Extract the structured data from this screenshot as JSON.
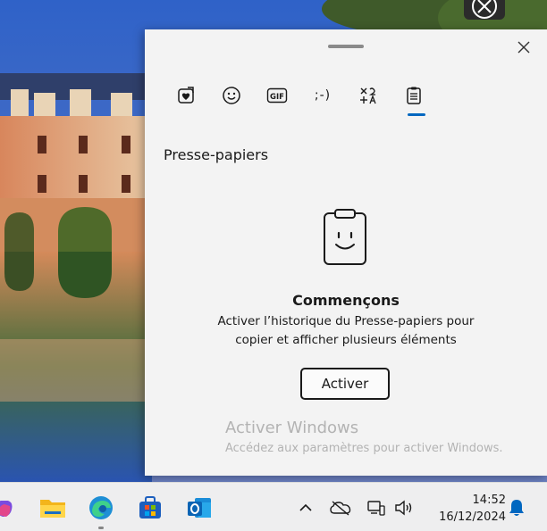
{
  "panel": {
    "tabs": [
      {
        "name": "favorites",
        "icon": "heart-icon"
      },
      {
        "name": "emoji",
        "icon": "smiley-icon"
      },
      {
        "name": "gif",
        "icon": "gif-icon",
        "label": "GIF"
      },
      {
        "name": "kaomoji",
        "icon": "kaomoji-icon",
        "label": ";-)"
      },
      {
        "name": "symbols",
        "icon": "symbols-icon"
      },
      {
        "name": "clipboard",
        "icon": "clipboard-icon",
        "selected": true
      }
    ],
    "section_title": "Presse-papiers",
    "empty_title": "Commençons",
    "empty_desc": "Activer l’historique du Presse-papiers pour copier et afficher plusieurs éléments",
    "activate_label": "Activer"
  },
  "watermark": {
    "title": "Activer Windows",
    "subtitle": "Accédez aux paramètres pour activer Windows."
  },
  "taskbar": {
    "apps": [
      "copilot-icon",
      "file-explorer-icon",
      "edge-icon",
      "store-icon",
      "outlook-icon"
    ],
    "tray": [
      "chevron-up-icon",
      "onedrive-icon",
      "network-icon",
      "volume-icon"
    ],
    "time": "14:52",
    "date": "16/12/2024"
  },
  "colors": {
    "accent": "#0067c0",
    "panel_bg": "#f3f3f3",
    "taskbar_bg": "#eeeeef"
  }
}
